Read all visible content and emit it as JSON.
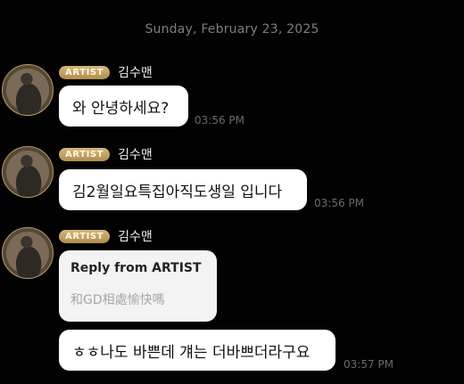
{
  "date_separator": "Sunday, February 23, 2025",
  "messages": [
    {
      "badge": "ARTIST",
      "sender": "김수맨",
      "text": "와 안녕하세요?",
      "time": "03:56 PM"
    },
    {
      "badge": "ARTIST",
      "sender": "김수맨",
      "text": "김2월일요특집아직도생일 입니다",
      "time": "03:56 PM"
    },
    {
      "badge": "ARTIST",
      "sender": "김수맨",
      "reply_title": "Reply from ARTIST",
      "reply_text": "和GD相處愉快嗎",
      "text": "ㅎㅎ나도 바쁜데 걔는 더바쁘더라구요",
      "time": "03:57 PM"
    }
  ]
}
